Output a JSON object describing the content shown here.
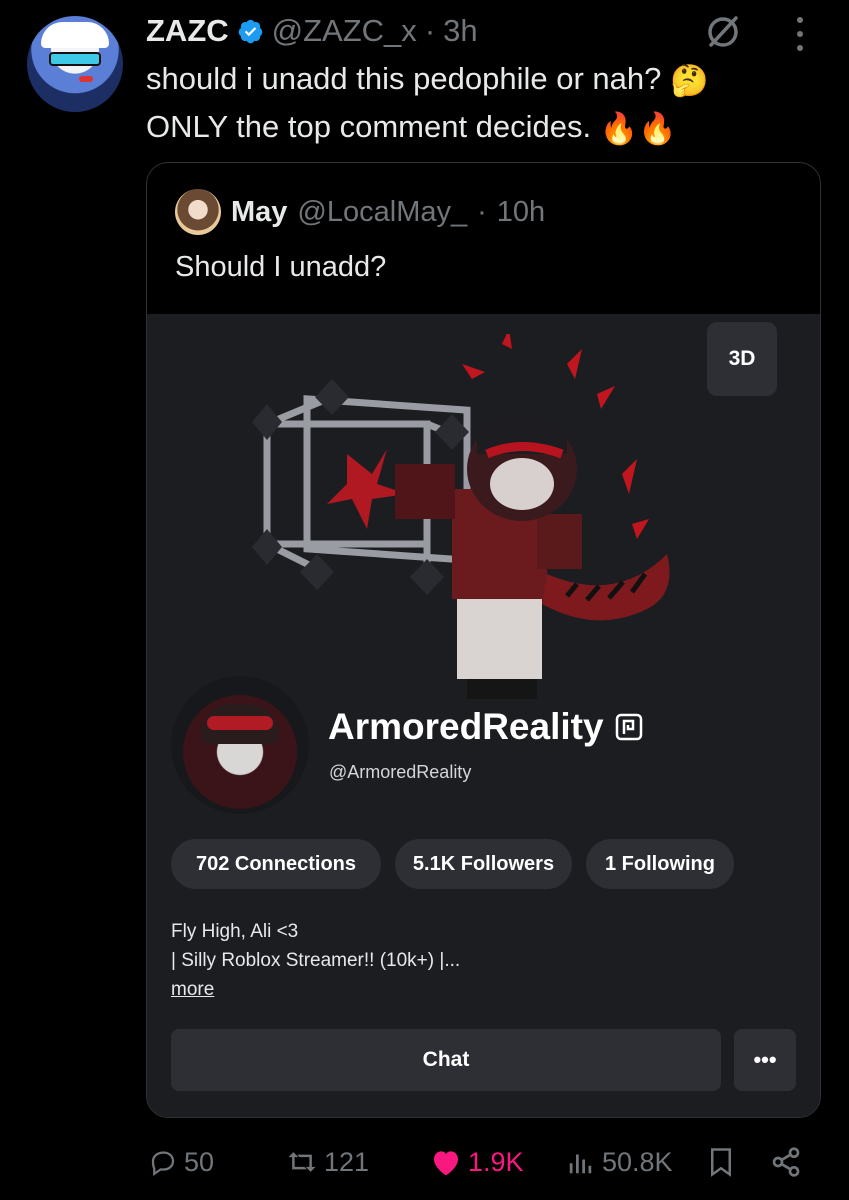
{
  "post": {
    "author_name": "ZAZC",
    "author_handle": "@ZAZC_x",
    "separator": "·",
    "time": "3h",
    "text_line1": "should i unadd this pedophile or nah?",
    "text_line1_emoji": "🤔",
    "text_line2": "ONLY the top comment decides.",
    "text_line2_emoji": "🔥🔥"
  },
  "quote": {
    "author_name": "May",
    "author_handle": "@LocalMay_",
    "separator": "·",
    "time": "10h",
    "text": "Should I unadd?"
  },
  "profile": {
    "view_3d_label": "3D",
    "display_name": "ArmoredReality",
    "username": "@ArmoredReality",
    "connections": "702 Connections",
    "followers": "5.1K Followers",
    "following": "1 Following",
    "bio_line1": "Fly High, Ali <3",
    "bio_line2": "| Silly Roblox Streamer!! (10k+) |...",
    "more_label": "more",
    "chat_label": "Chat",
    "more_options_label": "•••"
  },
  "actions": {
    "replies": "50",
    "reposts": "121",
    "likes": "1.9K",
    "views": "50.8K"
  },
  "colors": {
    "background": "#000000",
    "verified": "#1d9bf0",
    "like": "#f91880",
    "muted": "#71767b",
    "card": "#1c1d21",
    "pill": "#2e2f35"
  }
}
